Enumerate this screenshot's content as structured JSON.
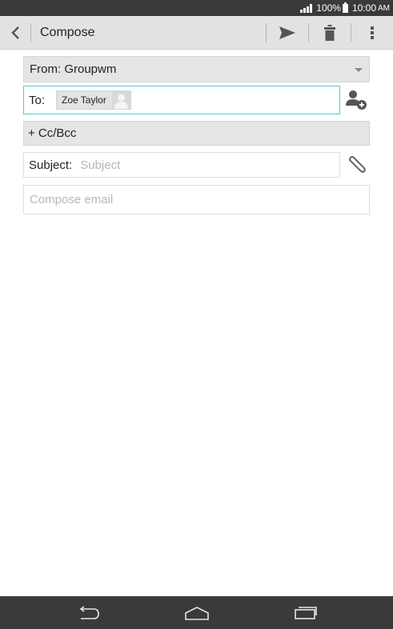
{
  "status_bar": {
    "battery_percent": "100%",
    "time": "10:00",
    "ampm": "AM"
  },
  "action_bar": {
    "title": "Compose",
    "back_icon": "chevron-left-icon",
    "send_icon": "send-icon",
    "delete_icon": "trash-icon",
    "overflow_icon": "more-vertical-icon"
  },
  "form": {
    "from_label": "From: Groupwm",
    "to_label": "To:",
    "recipients": [
      {
        "name": "Zoe Taylor"
      }
    ],
    "cc_bcc_label": "+ Cc/Bcc",
    "subject_label": "Subject:",
    "subject_placeholder": "Subject",
    "subject_value": "",
    "body_placeholder": "Compose email",
    "body_value": ""
  },
  "colors": {
    "status_bar": "#3a3a3a",
    "action_bar": "#e2e2e2",
    "focus_accent": "#5bc3d0",
    "field_gray": "#e5e5e5"
  }
}
